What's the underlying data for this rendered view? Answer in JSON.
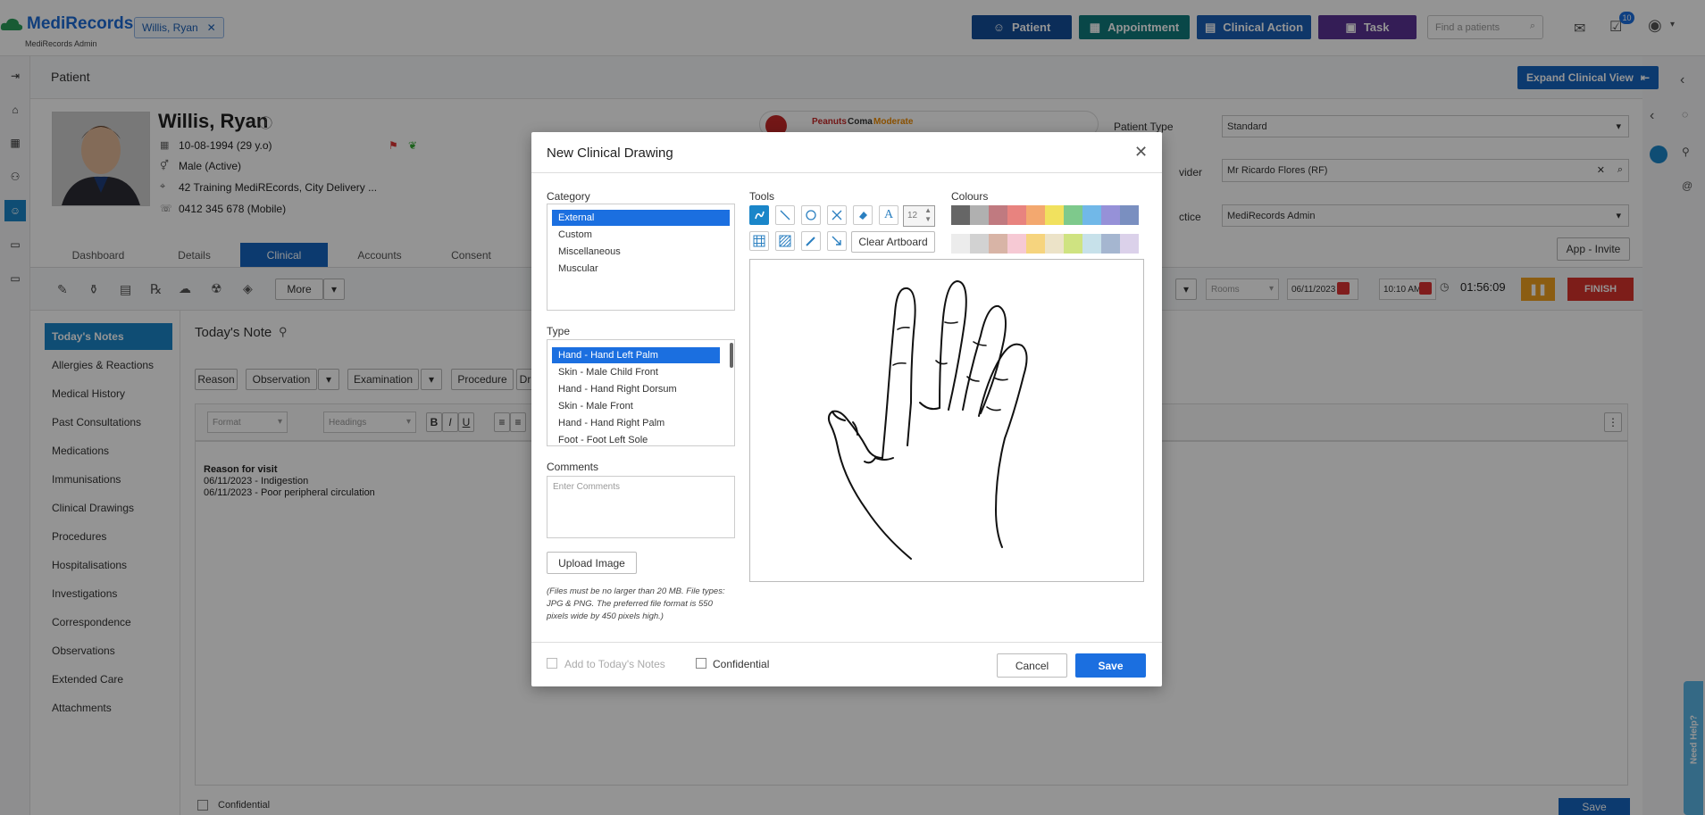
{
  "app": {
    "logo": "MediRecords",
    "sub": "MediRecords Admin"
  },
  "patient_chip": "Willis, Ryan",
  "top_buttons": [
    {
      "label": "Patient",
      "color": "#144e9a"
    },
    {
      "label": "Appointment",
      "color": "#117a7d"
    },
    {
      "label": "Clinical Action",
      "color": "#1b5fb5"
    },
    {
      "label": "Task",
      "color": "#5a3394"
    }
  ],
  "search": {
    "placeholder": "Find a patients"
  },
  "notif_count": "10",
  "page": {
    "title": "Patient",
    "expand_btn": "Expand Clinical View"
  },
  "patient": {
    "name": "Willis, Ryan",
    "dob": "10-08-1994 (29 y.o)",
    "gender": "Male (Active)",
    "address": "42 Training MediREcords, City Delivery ...",
    "phone": "0412 345 678 (Mobile)"
  },
  "alert": {
    "allergen": "Peanuts",
    "reaction": "Coma",
    "severity": "Moderate"
  },
  "patient_fields": [
    {
      "label": "Patient Type",
      "value": "Standard"
    },
    {
      "label": "vider",
      "value": "Mr Ricardo Flores (RF)"
    },
    {
      "label": "ctice",
      "value": "MediRecords Admin"
    }
  ],
  "app_invite": "App - Invite",
  "tabs": [
    "Dashboard",
    "Details",
    "Clinical",
    "Accounts",
    "Consent"
  ],
  "toolbar": {
    "more": "More",
    "rooms": "Rooms",
    "date": "06/11/2023",
    "time": "10:10 AM",
    "timer": "01:56:09",
    "finish": "FINISH"
  },
  "sidebar": [
    "Today's Notes",
    "Allergies & Reactions",
    "Medical History",
    "Past Consultations",
    "Medications",
    "Immunisations",
    "Clinical Drawings",
    "Procedures",
    "Hospitalisations",
    "Investigations",
    "Correspondence",
    "Observations",
    "Extended Care",
    "Attachments"
  ],
  "notes": {
    "title": "Today's Note",
    "buttons": [
      "Reason",
      "Observation",
      "Examination",
      "Procedure",
      "Dr"
    ],
    "format": "Format",
    "headings": "Headings",
    "content_heading": "Reason for visit",
    "lines": [
      "06/11/2023 - Indigestion",
      "06/11/2023 - Poor peripheral circulation"
    ],
    "confidential": "Confidential",
    "save": "Save"
  },
  "need_help": "Need Help?",
  "modal": {
    "title": "New Clinical Drawing",
    "category_label": "Category",
    "categories": [
      "External",
      "Custom",
      "Miscellaneous",
      "Muscular"
    ],
    "type_label": "Type",
    "types": [
      "Hand - Hand Left Palm",
      "Skin - Male Child Front",
      "Hand - Hand Right Dorsum",
      "Skin - Male Front",
      "Hand - Hand Right Palm",
      "Foot - Foot Left Sole"
    ],
    "comments_label": "Comments",
    "comments_placeholder": "Enter Comments",
    "upload": "Upload Image",
    "upload_note": "(Files must be no larger than 20 MB. File types: JPG & PNG. The preferred file format is 550 pixels wide by 450 pixels high.)",
    "tools_label": "Tools",
    "font_size": "12",
    "clear": "Clear Artboard",
    "colours_label": "Colours",
    "colours_row1": [
      "#666666",
      "#b0b0b0",
      "#c07a80",
      "#e8837f",
      "#f3a86f",
      "#f1e15e",
      "#7ec98c",
      "#71b8e8",
      "#9691d8",
      "#7a8fc0"
    ],
    "colours_row2": [
      "#ececec",
      "#d2d2d2",
      "#d8b4a6",
      "#f6c9d4",
      "#f6d47e",
      "#ece3c8",
      "#cfe381",
      "#c7e1ea",
      "#a5b6d0",
      "#dbd1ea"
    ],
    "add_notes": "Add to Today's Notes",
    "confidential": "Confidential",
    "cancel": "Cancel",
    "save": "Save"
  }
}
